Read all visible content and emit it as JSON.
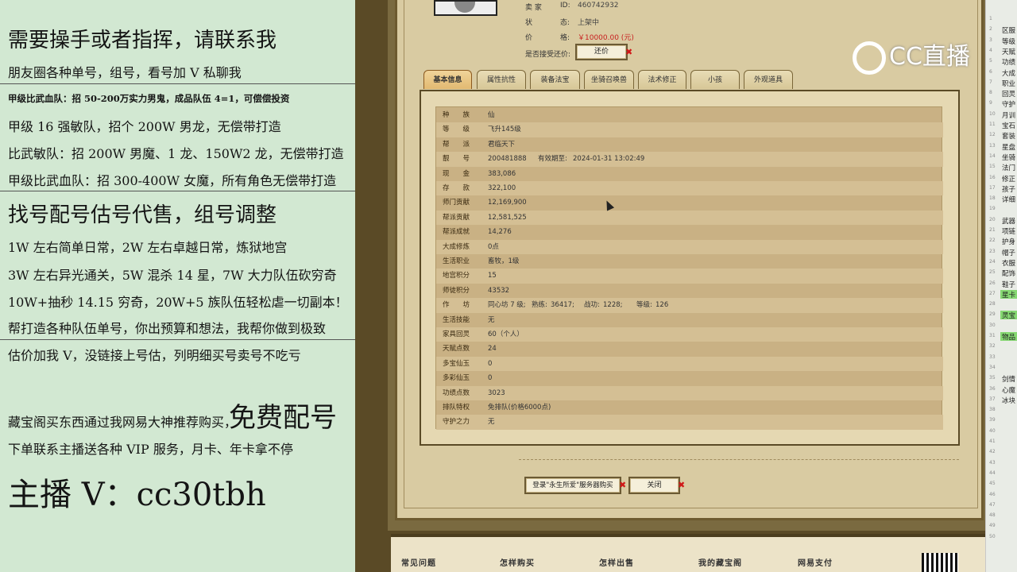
{
  "left_panel": {
    "lines": [
      "需要操手或者指挥，请联系我",
      "朋友圈各种单号，组号，看号加 V 私聊我",
      "甲级比武血队：招 50-200万实力男鬼，成品队伍 4=1，可偿偿投资",
      "甲级 16 强敏队，招个 200W 男龙，无偿带打造",
      "比武敏队：招 200W 男魔、1 龙、150W2 龙，无偿带打造",
      "甲级比武血队：招 300-400W 女魔，所有角色无偿带打造",
      "找号配号估号代售，组号调整",
      "1W 左右简单日常，2W 左右卓越日常，炼狱地宫",
      "3W 左右异光通关，5W 混杀 14 星，7W 大力队伍砍穷奇",
      "10W+抽秒 14.15 穷奇，20W+5 族队伍轻松虐一切副本！",
      "帮打造各种队伍单号，你出预算和想法，我帮你做到极致",
      "估价加我 V，没链接上号估，列明细买号卖号不吃亏",
      "藏宝阁买东西通过我网易大神推荐购买，",
      "免费配号",
      "下单联系主播送各种 VIP 服务，月卡、年卡拿不停",
      "主播 V：cc30tbh"
    ]
  },
  "seller": {
    "seller_label": "卖 家",
    "id_label": "ID:",
    "id_value": "460742932",
    "status_label": "状",
    "status_label2": "态:",
    "status_value": "上架中",
    "price_label": "价",
    "price_label2": "格:",
    "price_value": "￥10000.00 (元)",
    "bargain_label": "是否接受还价:",
    "bargain_button": "还价",
    "close_mark": "✖"
  },
  "tabs": [
    "基本信息",
    "属性抗性",
    "装备法宝",
    "坐骑召唤兽",
    "法术修正",
    "小孩",
    "外观道具"
  ],
  "info_rows": [
    {
      "k": "种　　族",
      "v": "仙",
      "style": "green"
    },
    {
      "k": "等　　级",
      "v": "飞升145级",
      "style": "green"
    },
    {
      "k": "帮　　派",
      "v": "君临天下",
      "style": "green"
    },
    {
      "k": "靓　　号",
      "v": "200481888",
      "extra_label": "有效期至:",
      "extra_value": "2024-01-31 13:02:49"
    },
    {
      "k": "现　　金",
      "v": "383,086",
      "style": "mag"
    },
    {
      "k": "存　　款",
      "v": "322,100",
      "style": "mag"
    },
    {
      "k": "师门贡献",
      "v": "12,169,900"
    },
    {
      "k": "帮派贡献",
      "v": "12,581,525"
    },
    {
      "k": "帮派成就",
      "v": "14,276"
    },
    {
      "k": "大成修炼",
      "v": "0点"
    },
    {
      "k": "生活职业",
      "v": "畜牧，1级"
    },
    {
      "k": "地宫积分",
      "v": "15"
    },
    {
      "k": "师徒积分",
      "v": "43532"
    },
    {
      "k": "作　　坊",
      "v": "同心坊 7 级;",
      "extra_label": "熟练:",
      "extra_value": "36417;",
      "extra_label2": "战功:",
      "extra_value2": "1228;",
      "extra_label3": "等级:",
      "extra_value3": "126"
    },
    {
      "k": "生活技能",
      "v": "无"
    },
    {
      "k": "家具回灵",
      "v": "60（个人）"
    },
    {
      "k": "天赋点数",
      "v": "24"
    },
    {
      "k": "多宝仙玉",
      "v": "0"
    },
    {
      "k": "多彩仙玉",
      "v": "0"
    },
    {
      "k": "功绩点数",
      "v": "3023"
    },
    {
      "k": "排队特权",
      "v": "免排队(价格6000点)"
    },
    {
      "k": "守护之力",
      "v": "无",
      "style": "green"
    }
  ],
  "bottom_buttons": {
    "login": "登录\"永生所爱\"服务器购买",
    "close": "关闭"
  },
  "footer": [
    "常见问题",
    "怎样购买",
    "怎样出售",
    "我的藏宝阁",
    "网易支付"
  ],
  "watermark": "CC直播",
  "strip": {
    "numbers": [
      "1",
      "2",
      "3",
      "4",
      "5",
      "6",
      "7",
      "8",
      "9",
      "10",
      "11",
      "12",
      "13",
      "14",
      "15",
      "16",
      "17",
      "18",
      "19",
      "20",
      "21",
      "22",
      "23",
      "24",
      "25",
      "26",
      "27",
      "28",
      "29",
      "30",
      "31",
      "32",
      "33",
      "34",
      "35",
      "36",
      "37",
      "38",
      "39",
      "40",
      "41",
      "42",
      "43",
      "44",
      "45",
      "46",
      "47",
      "48",
      "49",
      "50"
    ],
    "texts": [
      {
        "row": 2,
        "text": "区服"
      },
      {
        "row": 3,
        "text": "等级"
      },
      {
        "row": 4,
        "text": "天赋"
      },
      {
        "row": 5,
        "text": "功绩"
      },
      {
        "row": 6,
        "text": "大成"
      },
      {
        "row": 7,
        "text": "职业"
      },
      {
        "row": 8,
        "text": "回灵"
      },
      {
        "row": 9,
        "text": "守护"
      },
      {
        "row": 10,
        "text": "月训"
      },
      {
        "row": 11,
        "text": "宝石"
      },
      {
        "row": 12,
        "text": "套装"
      },
      {
        "row": 13,
        "text": "星盘"
      },
      {
        "row": 14,
        "text": "坐骑"
      },
      {
        "row": 15,
        "text": "法门"
      },
      {
        "row": 16,
        "text": "修正"
      },
      {
        "row": 17,
        "text": "孩子"
      },
      {
        "row": 18,
        "text": "详细"
      },
      {
        "row": 20,
        "text": "武器"
      },
      {
        "row": 21,
        "text": "项链"
      },
      {
        "row": 22,
        "text": "护身"
      },
      {
        "row": 23,
        "text": "帽子"
      },
      {
        "row": 24,
        "text": "衣服"
      },
      {
        "row": 25,
        "text": "配饰"
      },
      {
        "row": 26,
        "text": "鞋子"
      },
      {
        "row": 27,
        "text": "星卡",
        "hl": true
      },
      {
        "row": 29,
        "text": "灵宝",
        "hl": true
      },
      {
        "row": 31,
        "text": "物品",
        "hl": true
      },
      {
        "row": 35,
        "text": "剑情"
      },
      {
        "row": 36,
        "text": "心魔"
      },
      {
        "row": 37,
        "text": "冰块"
      }
    ]
  }
}
